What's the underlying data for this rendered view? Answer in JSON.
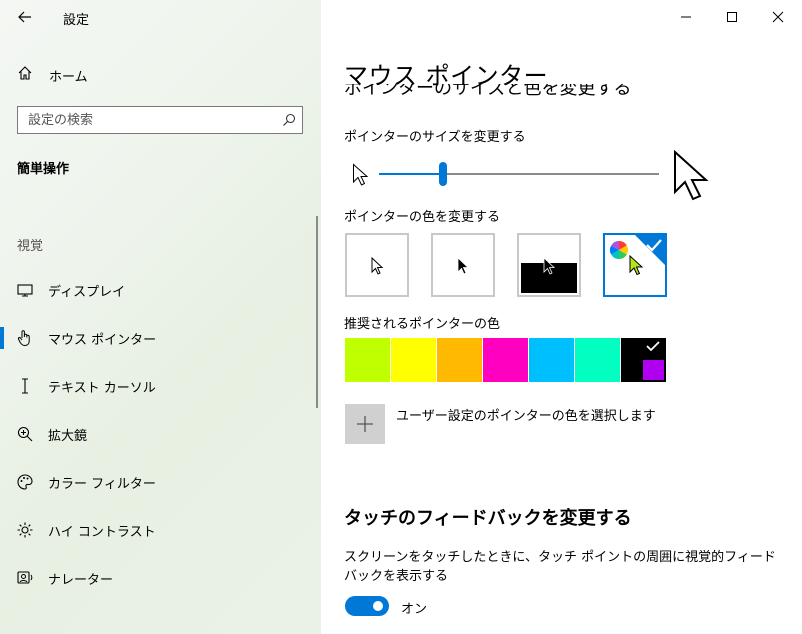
{
  "app": {
    "title": "設定"
  },
  "nav": {
    "home_label": "ホーム",
    "search_placeholder": "設定の検索",
    "section_title": "簡単操作",
    "group_label": "視覚",
    "items": [
      {
        "label": "ディスプレイ",
        "icon": "monitor-icon"
      },
      {
        "label": "マウス ポインター",
        "icon": "hand-pointer-icon",
        "active": true
      },
      {
        "label": "テキスト カーソル",
        "icon": "text-cursor-icon"
      },
      {
        "label": "拡大鏡",
        "icon": "magnifier-icon"
      },
      {
        "label": "カラー フィルター",
        "icon": "palette-icon"
      },
      {
        "label": "ハイ コントラスト",
        "icon": "brightness-icon"
      },
      {
        "label": "ナレーター",
        "icon": "narrator-icon"
      }
    ]
  },
  "main": {
    "page_title": "マウス ポインター",
    "clipped_heading": "ポインターのサイズと色を変更する",
    "size_label": "ポインターのサイズを変更する",
    "size_value_fraction": 0.22,
    "color_label": "ポインターの色を変更する",
    "color_options": [
      "white-pointer",
      "black-pointer",
      "inverted-pointer",
      "custom-pointer"
    ],
    "selected_color_option": 3,
    "recommended_label": "推奨されるポインターの色",
    "recommended_colors": [
      "#bfff00",
      "#ffff00",
      "#ffb900",
      "#ff00c0",
      "#00bfff",
      "#00ffc0",
      "#b000f0"
    ],
    "selected_recommended": 6,
    "add_custom_label": "ユーザー設定のポインターの色を選択します",
    "touch_heading": "タッチのフィードバックを変更する",
    "touch_desc": "スクリーンをタッチしたときに、タッチ ポイントの周囲に視覚的フィードバックを表示する",
    "toggle_label": "オン",
    "toggle_on": true,
    "accent_color": "#0078d7"
  }
}
